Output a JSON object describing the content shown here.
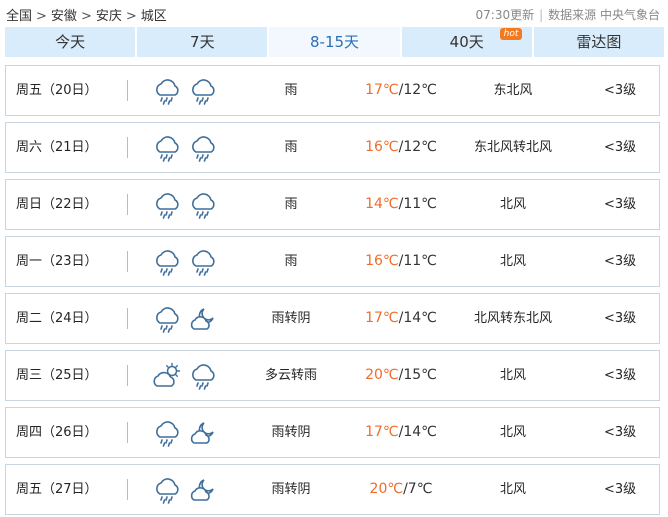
{
  "breadcrumb": [
    "全国",
    "安徽",
    "安庆",
    "城区"
  ],
  "update_time": "07:30更新",
  "source_label": "数据来源 中央气象台",
  "tabs": [
    {
      "label": "今天"
    },
    {
      "label": "7天"
    },
    {
      "label": "8-15天",
      "active": true
    },
    {
      "label": "40天",
      "badge": "hot"
    },
    {
      "label": "雷达图"
    }
  ],
  "colors": {
    "high_temp": "#ef6c2c",
    "tab_bg": "#d9ecfb",
    "tab_active_text": "#2a6fb5",
    "badge": "#f47a20"
  },
  "forecast": [
    {
      "day": "周五（20日）",
      "icons": [
        "rain-icon",
        "rain-icon"
      ],
      "condition": "雨",
      "high": "17℃",
      "low": "/12℃",
      "wind": "东北风",
      "level": "<3级"
    },
    {
      "day": "周六（21日）",
      "icons": [
        "rain-icon",
        "rain-icon"
      ],
      "condition": "雨",
      "high": "16℃",
      "low": "/12℃",
      "wind": "东北风转北风",
      "level": "<3级"
    },
    {
      "day": "周日（22日）",
      "icons": [
        "rain-icon",
        "rain-icon"
      ],
      "condition": "雨",
      "high": "14℃",
      "low": "/11℃",
      "wind": "北风",
      "level": "<3级"
    },
    {
      "day": "周一（23日）",
      "icons": [
        "rain-icon",
        "rain-icon"
      ],
      "condition": "雨",
      "high": "16℃",
      "low": "/11℃",
      "wind": "北风",
      "level": "<3级"
    },
    {
      "day": "周二（24日）",
      "icons": [
        "rain-icon",
        "cloudy-night-icon"
      ],
      "condition": "雨转阴",
      "high": "17℃",
      "low": "/14℃",
      "wind": "北风转东北风",
      "level": "<3级"
    },
    {
      "day": "周三（25日）",
      "icons": [
        "partly-cloudy-icon",
        "rain-icon"
      ],
      "condition": "多云转雨",
      "high": "20℃",
      "low": "/15℃",
      "wind": "北风",
      "level": "<3级"
    },
    {
      "day": "周四（26日）",
      "icons": [
        "rain-icon",
        "cloudy-night-icon"
      ],
      "condition": "雨转阴",
      "high": "17℃",
      "low": "/14℃",
      "wind": "北风",
      "level": "<3级"
    },
    {
      "day": "周五（27日）",
      "icons": [
        "rain-icon",
        "cloudy-night-icon"
      ],
      "condition": "雨转阴",
      "high": "20℃",
      "low": "/7℃",
      "wind": "北风",
      "level": "<3级"
    }
  ]
}
